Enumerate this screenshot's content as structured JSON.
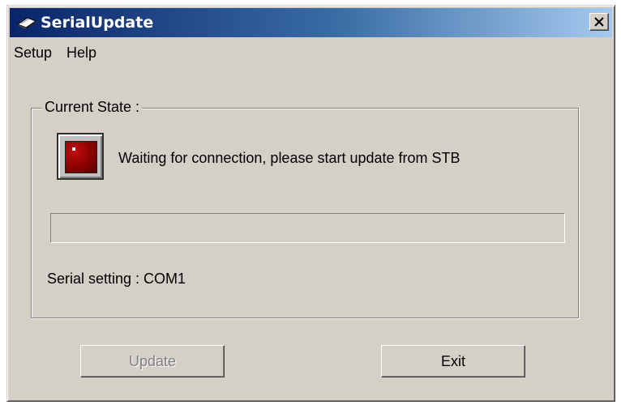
{
  "window": {
    "title": "SerialUpdate",
    "app_icon": "chip-icon",
    "close_icon": "close-icon"
  },
  "menu": {
    "items": [
      "Setup",
      "Help"
    ]
  },
  "current_state": {
    "label": "Current State :",
    "status_message": "Waiting for connection, please start update from STB",
    "indicator_icon": "status-lamp-icon",
    "indicator_color": "#8a0000",
    "progress_percent": 0,
    "serial_setting_text": "Serial setting : COM1"
  },
  "buttons": {
    "update_label": "Update",
    "update_enabled": false,
    "exit_label": "Exit"
  },
  "colors": {
    "title_gradient_start": "#0a246a",
    "title_gradient_end": "#a6caf0",
    "face": "#d4d0c8"
  }
}
